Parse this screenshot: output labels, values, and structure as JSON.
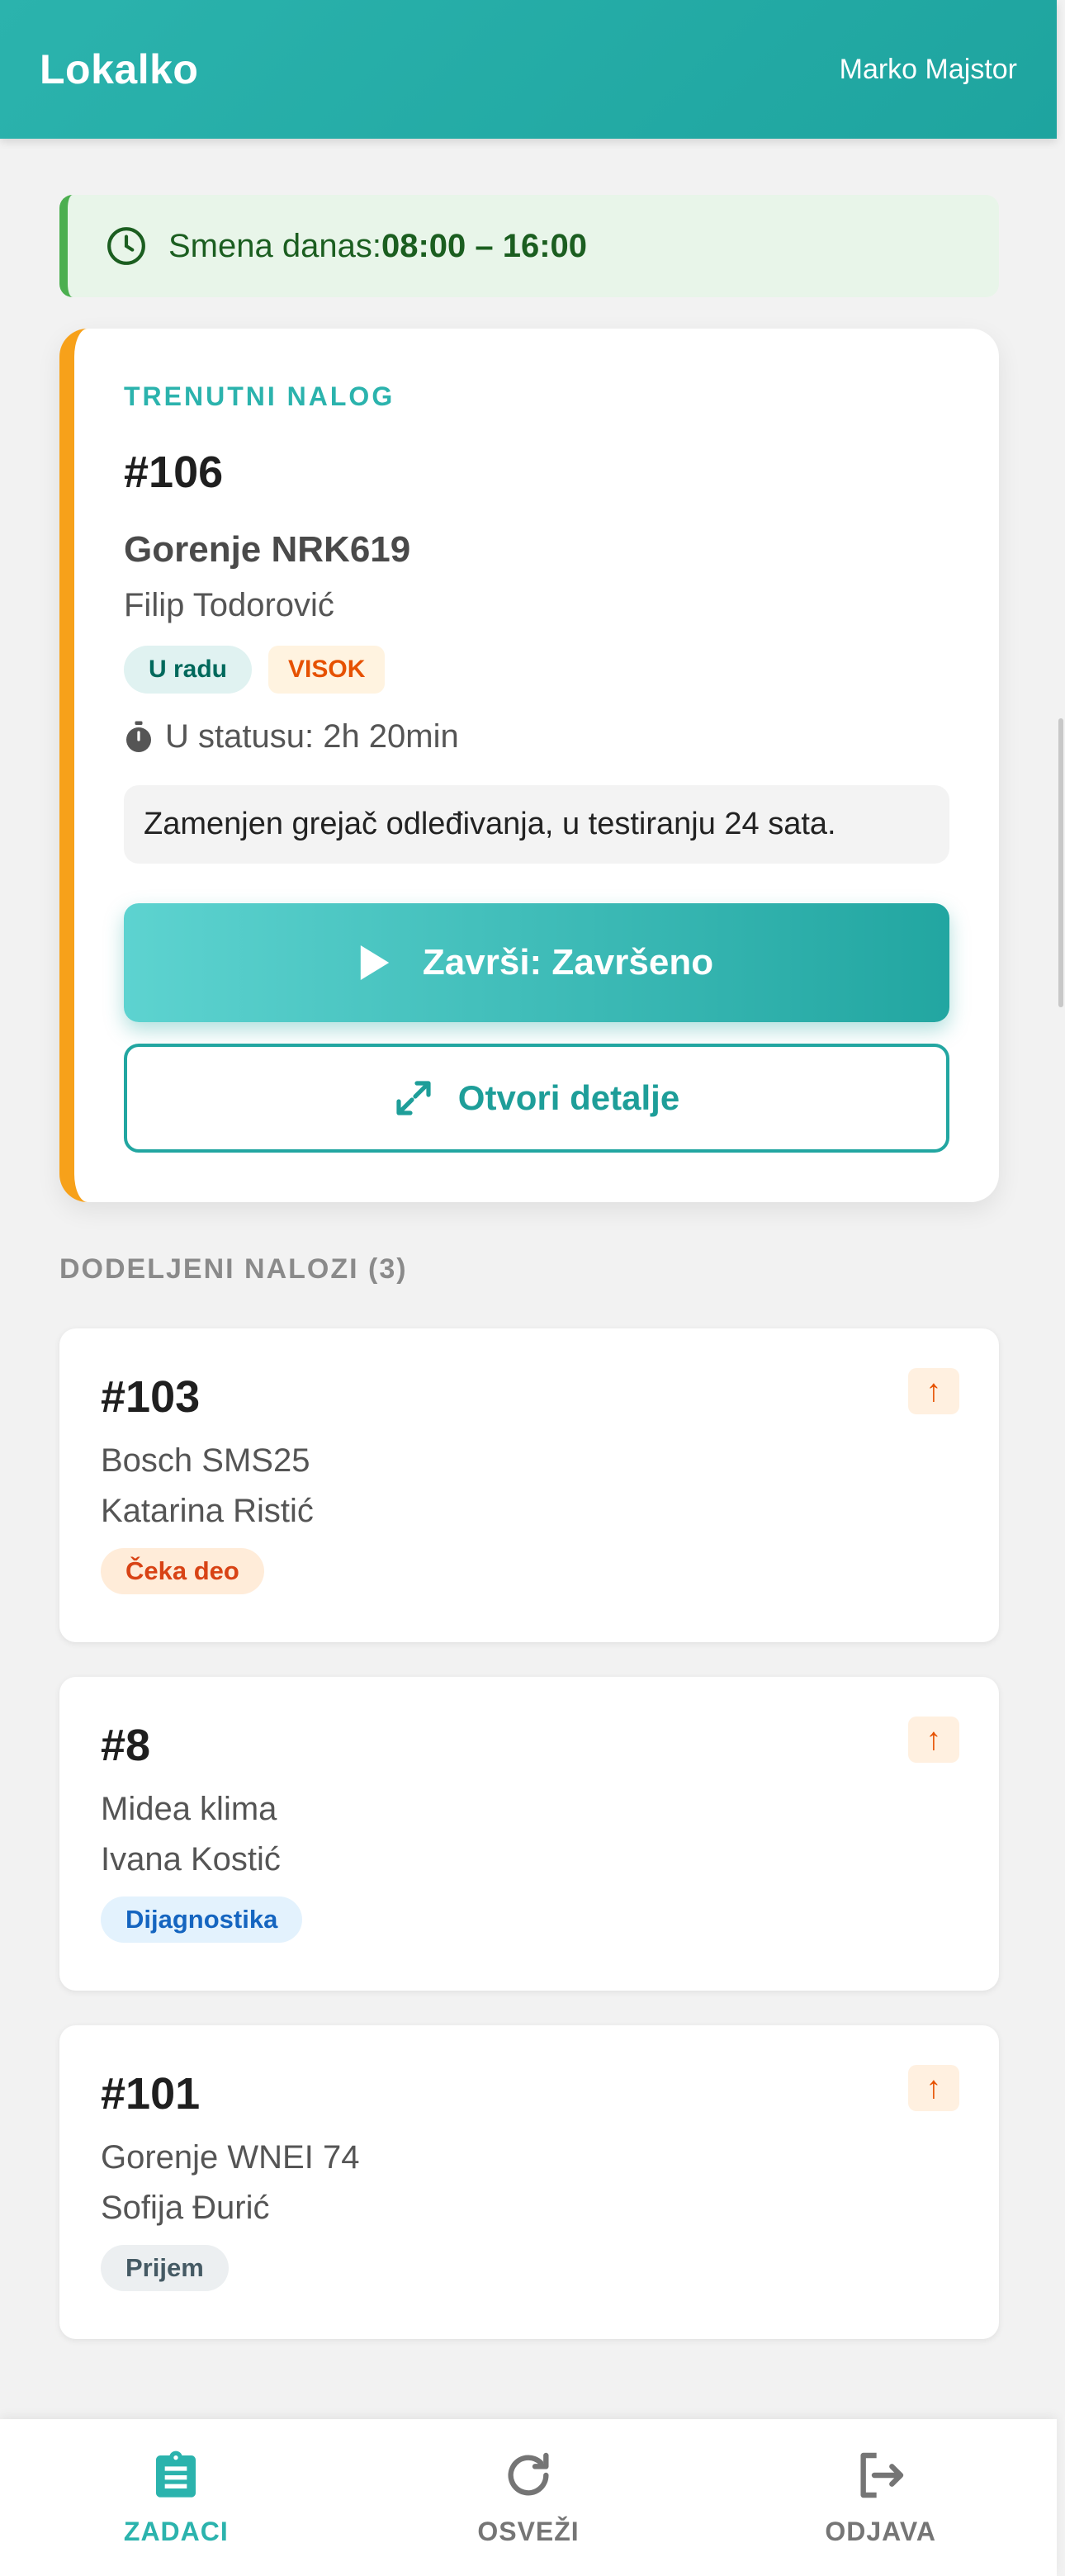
{
  "app": {
    "title": "Lokalko",
    "user_name": "Marko Majstor"
  },
  "shift": {
    "label": "Smena danas: ",
    "hours": "08:00 – 16:00",
    "icon": "clock-icon"
  },
  "current_order": {
    "kicker": "TRENUTNI NALOG",
    "id": "#106",
    "device": "Gorenje NRK619",
    "customer": "Filip Todorović",
    "status_badge": "U radu",
    "priority_badge": "VISOK",
    "duration": "U statusu: 2h 20min",
    "note": "Zamenjen grejač odleđivanja, u testiranju 24 sata.",
    "primary_action": "Završi: Završeno",
    "secondary_action": "Otvori detalje",
    "colors": {
      "accent": "#2bb3ad",
      "left_border": "#f7a11a"
    }
  },
  "assigned": {
    "title": "DODELJENI NALOZI (3)",
    "items": [
      {
        "id": "#103",
        "device": "Bosch SMS25",
        "customer": "Katarina Ristić",
        "status": "Čeka deo",
        "priority_icon": "↑"
      },
      {
        "id": "#8",
        "device": "Midea klima",
        "customer": "Ivana Kostić",
        "status": "Dijagnostika",
        "priority_icon": "↑"
      },
      {
        "id": "#101",
        "device": "Gorenje WNEI 74",
        "customer": "Sofija Đurić",
        "status": "Prijem",
        "priority_icon": "↑"
      }
    ]
  },
  "nav": {
    "items": [
      {
        "label": "ZADACI",
        "icon": "clipboard-icon",
        "active": true
      },
      {
        "label": "OSVEŽI",
        "icon": "refresh-icon",
        "active": false
      },
      {
        "label": "ODJAVA",
        "icon": "logout-icon",
        "active": false
      }
    ]
  }
}
